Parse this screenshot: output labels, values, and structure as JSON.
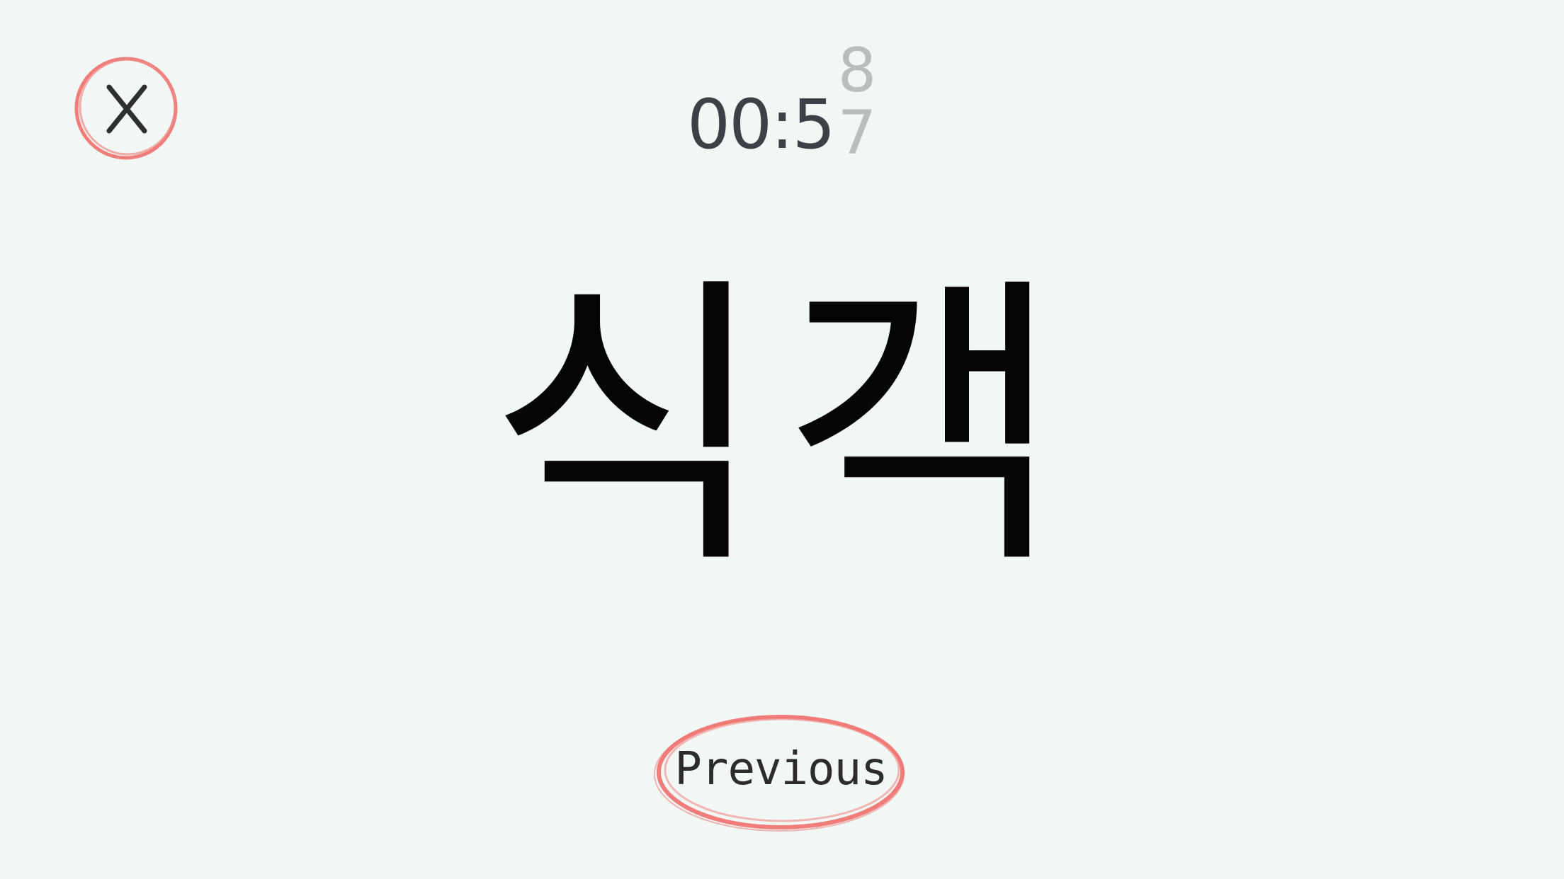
{
  "timer": {
    "display": "00:5",
    "next_digit": "8",
    "current_digit": "7"
  },
  "card": {
    "word": "식객"
  },
  "buttons": {
    "previous_label": "Previous",
    "close_icon": "close-icon"
  },
  "colors": {
    "background": "#f1f7f5",
    "accent_ring": "#ef6f6c",
    "text": "#050505",
    "timer_text": "#3d4147",
    "timer_faded": "#b9bdbc"
  }
}
